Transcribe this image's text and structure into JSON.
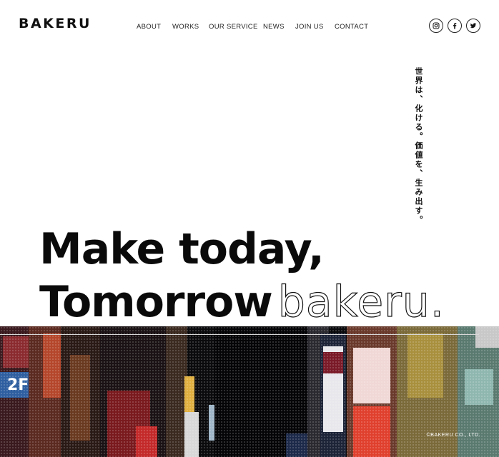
{
  "header": {
    "logo": "BAKERU",
    "nav": [
      "ABOUT",
      "WORKS",
      "OUR SERVICE",
      "NEWS",
      "JOIN US",
      "CONTACT"
    ],
    "social": [
      "instagram-icon",
      "facebook-icon",
      "twitter-icon"
    ]
  },
  "hero": {
    "tagline": "世界は、化ける。価値を、生み出す。",
    "line1": "Make today,",
    "line2_solid": "Tomorrow",
    "line2_outline": "bakeru."
  },
  "photo": {
    "sign_2f": "2F",
    "copyright": "©BAKERU CO., LTD."
  },
  "colors": {
    "text": "#111111",
    "background": "#ffffff",
    "photo_dark": "#0b0b0d"
  }
}
